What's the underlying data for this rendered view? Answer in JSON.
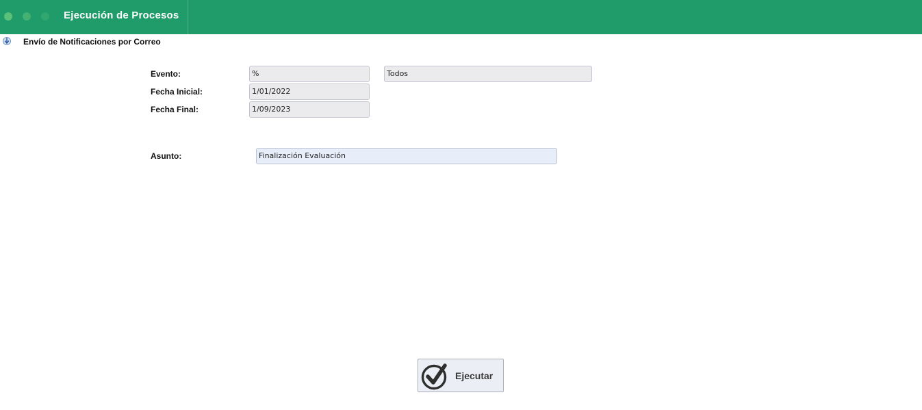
{
  "header": {
    "title": "Ejecución de Procesos"
  },
  "section": {
    "title": "Envío de Notificaciones por Correo",
    "icon": "down-arrow-info-icon"
  },
  "form": {
    "evento": {
      "label": "Evento:",
      "code_value": "%",
      "desc_value": "Todos"
    },
    "fecha_inicial": {
      "label": "Fecha Inicial:",
      "value": "1/01/2022"
    },
    "fecha_final": {
      "label": "Fecha Final:",
      "value": "1/09/2023"
    },
    "asunto": {
      "label": "Asunto:",
      "value": "Finalización Evaluación"
    }
  },
  "actions": {
    "execute_label": "Ejecutar",
    "execute_icon": "checkmark-circle-icon"
  },
  "colors": {
    "header_bg": "#209b6a",
    "field_bg": "#ebebee",
    "asunto_bg": "#e8eef9"
  }
}
